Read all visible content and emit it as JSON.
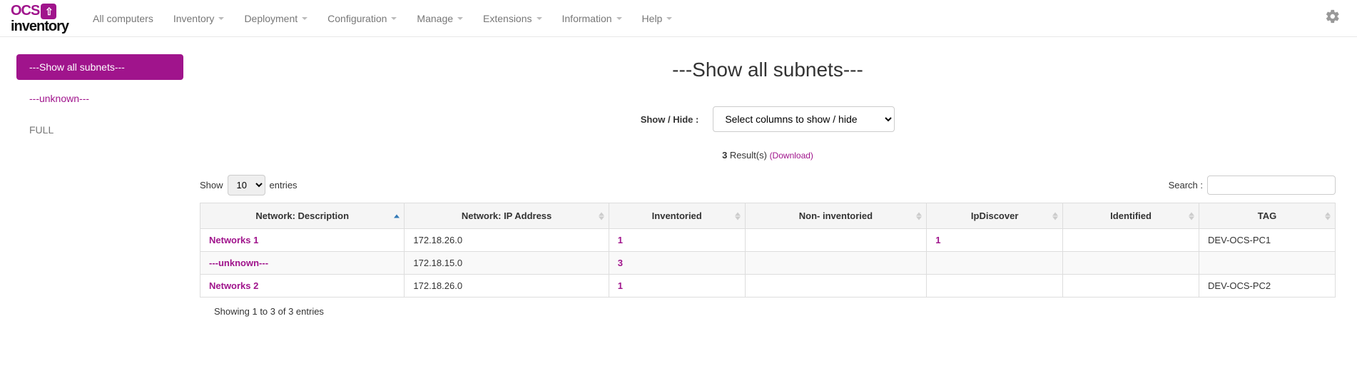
{
  "nav": {
    "all_computers": "All computers",
    "inventory": "Inventory",
    "deployment": "Deployment",
    "configuration": "Configuration",
    "manage": "Manage",
    "extensions": "Extensions",
    "information": "Information",
    "help": "Help"
  },
  "sidebar": {
    "show_all": "---Show all subnets---",
    "unknown": "---unknown---",
    "full": "FULL"
  },
  "page": {
    "title": "---Show all subnets---",
    "show_hide_label": "Show / Hide :",
    "show_hide_option": "Select columns to show / hide",
    "results_count": "3",
    "results_word": "Result(s)",
    "download": "(Download)",
    "show_word": "Show",
    "entries_word": "entries",
    "entries_value": "10",
    "search_label": "Search :",
    "info": "Showing 1 to 3 of 3 entries"
  },
  "columns": {
    "c0": "Network: Description",
    "c1": "Network: IP Address",
    "c2": "Inventoried",
    "c3": "Non- inventoried",
    "c4": "IpDiscover",
    "c5": "Identified",
    "c6": "TAG"
  },
  "rows": [
    {
      "desc": "Networks 1",
      "ip": "172.18.26.0",
      "inv": "1",
      "noninv": "",
      "ipd": "1",
      "ident": "",
      "tag": "DEV-OCS-PC1"
    },
    {
      "desc": "---unknown---",
      "ip": "172.18.15.0",
      "inv": "3",
      "noninv": "",
      "ipd": "",
      "ident": "",
      "tag": ""
    },
    {
      "desc": "Networks 2",
      "ip": "172.18.26.0",
      "inv": "1",
      "noninv": "",
      "ipd": "",
      "ident": "",
      "tag": "DEV-OCS-PC2"
    }
  ]
}
